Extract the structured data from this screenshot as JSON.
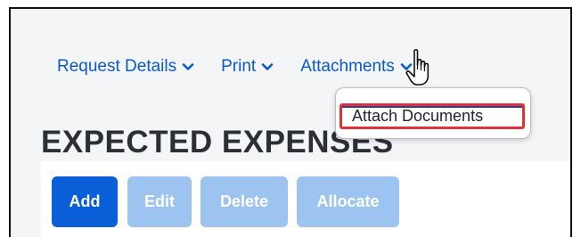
{
  "menu": {
    "items": [
      {
        "label": "Request Details"
      },
      {
        "label": "Print"
      },
      {
        "label": "Attachments"
      }
    ]
  },
  "dropdown": {
    "option": "Attach Documents"
  },
  "section": {
    "title": "EXPECTED EXPENSES"
  },
  "toolbar": {
    "add_label": "Add",
    "edit_label": "Edit",
    "delete_label": "Delete",
    "allocate_label": "Allocate"
  },
  "colors": {
    "accent": "#0a59c9",
    "primary_button": "#0a5ed7",
    "disabled_button": "#9dc3f0",
    "highlight": "#e0313a"
  },
  "icons": {
    "chevron": "chevron-down-icon",
    "cursor": "hand-pointer-icon"
  }
}
